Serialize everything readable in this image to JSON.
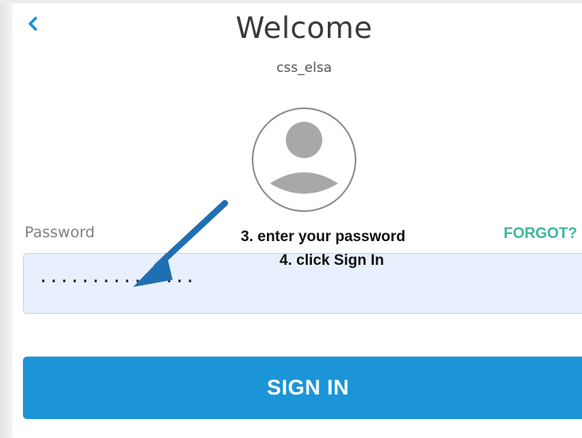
{
  "header": {
    "title": "Welcome",
    "username": "css_elsa",
    "back_icon": "chevron-left-icon"
  },
  "avatar": {
    "icon": "user-avatar-icon"
  },
  "form": {
    "password_label": "Password",
    "password_value": "...............",
    "forgot_label": "FORGOT?",
    "signin_label": "SIGN IN"
  },
  "annotations": {
    "step3": "3. enter your password",
    "step4": "4. click Sign In",
    "arrow_icon": "pointer-arrow-icon"
  },
  "colors": {
    "accent": "#1b95d8",
    "link": "#3fb6a0",
    "input_bg": "#e8f0fd",
    "arrow": "#1f6fb3"
  }
}
